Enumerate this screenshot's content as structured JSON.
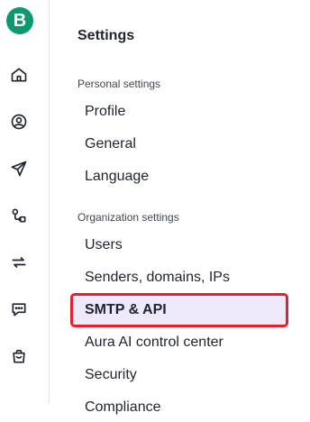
{
  "brand": {
    "logo_letter": "B",
    "color": "#0b996e"
  },
  "rail": {
    "icons": [
      {
        "name": "home-icon"
      },
      {
        "name": "contacts-icon"
      },
      {
        "name": "campaigns-icon"
      },
      {
        "name": "automations-icon"
      },
      {
        "name": "transactional-icon"
      },
      {
        "name": "conversations-icon"
      },
      {
        "name": "sales-icon"
      }
    ]
  },
  "settings": {
    "title": "Settings",
    "personal_label": "Personal settings",
    "personal_items": [
      "Profile",
      "General",
      "Language"
    ],
    "organization_label": "Organization settings",
    "organization_items": [
      "Users",
      "Senders, domains, IPs",
      "SMTP & API",
      "Aura AI control center",
      "Security",
      "Compliance"
    ],
    "active_item": "SMTP & API"
  },
  "colors": {
    "active_bg": "#eeeafc",
    "highlight_border": "#e0212e"
  }
}
